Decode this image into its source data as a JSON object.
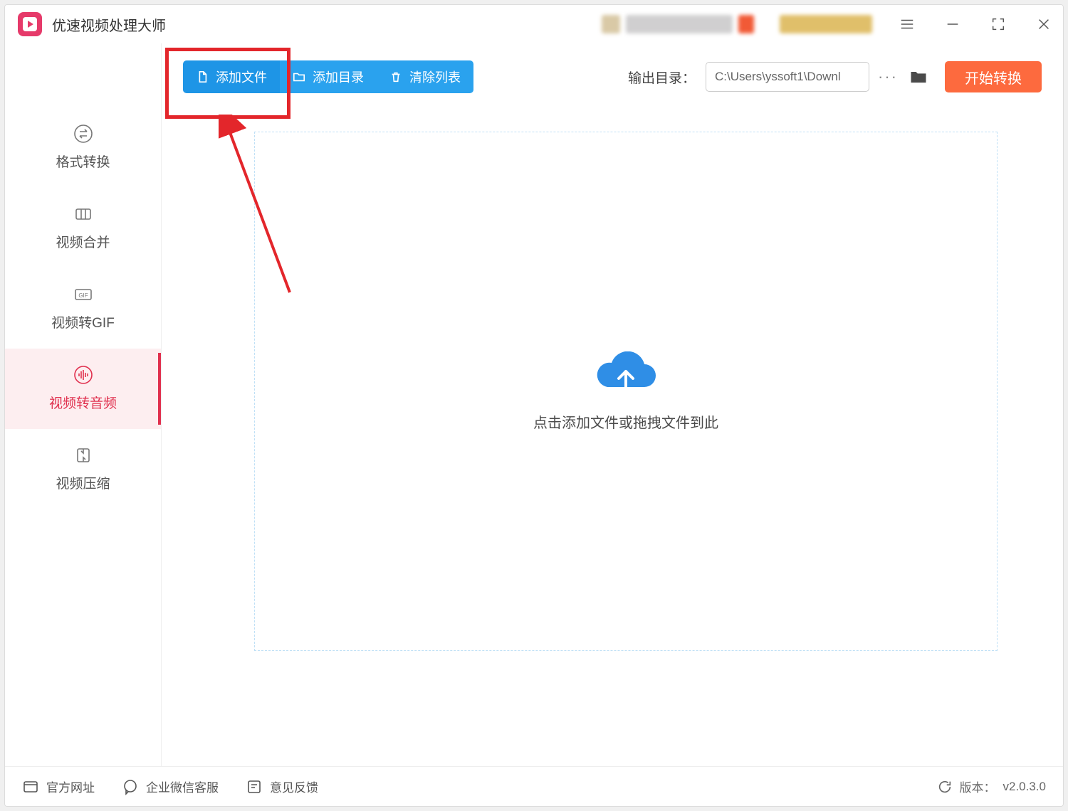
{
  "app": {
    "title": "优速视频处理大师"
  },
  "window_buttons": {
    "menu": "menu",
    "minimize": "minimize",
    "fullscreen": "fullscreen",
    "close": "close"
  },
  "sidebar": {
    "items": [
      {
        "label": "格式转换",
        "icon": "swap-icon",
        "active": false
      },
      {
        "label": "视频合并",
        "icon": "merge-icon",
        "active": false
      },
      {
        "label": "视频转GIF",
        "icon": "gif-icon",
        "active": false
      },
      {
        "label": "视频转音频",
        "icon": "audio-icon",
        "active": true
      },
      {
        "label": "视频压缩",
        "icon": "compress-icon",
        "active": false
      }
    ]
  },
  "toolbar": {
    "add_file": "添加文件",
    "add_folder": "添加目录",
    "clear_list": "清除列表",
    "outdir_label": "输出目录：",
    "outdir_path": "C:\\Users\\yssoft1\\Downl",
    "more": "···",
    "start": "开始转换"
  },
  "dropzone": {
    "text": "点击添加文件或拖拽文件到此"
  },
  "footer": {
    "official_site": "官方网址",
    "wecom_support": "企业微信客服",
    "feedback": "意见反馈",
    "version_label": "版本：",
    "version_value": "v2.0.3.0"
  },
  "annotation": {
    "highlight_target": "add-file-button"
  }
}
